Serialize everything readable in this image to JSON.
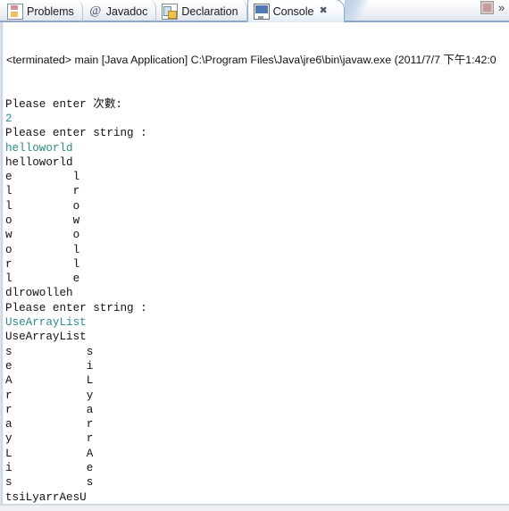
{
  "window": {
    "title": "Eclipse Console View"
  },
  "tabs": [
    {
      "label": "Problems",
      "icon": "problems-icon",
      "active": false,
      "closable": false
    },
    {
      "label": "Javadoc",
      "icon": "javadoc-icon",
      "active": false,
      "closable": false
    },
    {
      "label": "Declaration",
      "icon": "declaration-icon",
      "active": false,
      "closable": false
    },
    {
      "label": "Console",
      "icon": "console-icon",
      "active": true,
      "closable": true
    }
  ],
  "tab_close_glyph": "✖",
  "toolbar": {
    "terminate_icon": "stop-terminate-icon",
    "menu_icon": "view-menu-chevrons-icon",
    "menu_glyph": "»"
  },
  "console": {
    "launch_line": "<terminated> main [Java Application] C:\\Program Files\\Java\\jre6\\bin\\javaw.exe (2011/7/7 下午1:42:0",
    "colors": {
      "stdout": "#111111",
      "stdin": "#2e8b8b",
      "background": "#ffffff"
    },
    "lines": [
      {
        "text": "Please enter 次數:",
        "stream": "out"
      },
      {
        "text": "2",
        "stream": "in"
      },
      {
        "text": "Please enter string :",
        "stream": "out"
      },
      {
        "text": "helloworld",
        "stream": "in"
      },
      {
        "text": "helloworld",
        "stream": "out"
      },
      {
        "text": "e         l",
        "stream": "out"
      },
      {
        "text": "l         r",
        "stream": "out"
      },
      {
        "text": "l         o",
        "stream": "out"
      },
      {
        "text": "o         w",
        "stream": "out"
      },
      {
        "text": "w         o",
        "stream": "out"
      },
      {
        "text": "o         l",
        "stream": "out"
      },
      {
        "text": "r         l",
        "stream": "out"
      },
      {
        "text": "l         e",
        "stream": "out"
      },
      {
        "text": "dlrowolleh",
        "stream": "out"
      },
      {
        "text": "Please enter string :",
        "stream": "out"
      },
      {
        "text": "UseArrayList",
        "stream": "in"
      },
      {
        "text": "UseArrayList",
        "stream": "out"
      },
      {
        "text": "s           s",
        "stream": "out"
      },
      {
        "text": "e           i",
        "stream": "out"
      },
      {
        "text": "A           L",
        "stream": "out"
      },
      {
        "text": "r           y",
        "stream": "out"
      },
      {
        "text": "r           a",
        "stream": "out"
      },
      {
        "text": "a           r",
        "stream": "out"
      },
      {
        "text": "y           r",
        "stream": "out"
      },
      {
        "text": "L           A",
        "stream": "out"
      },
      {
        "text": "i           e",
        "stream": "out"
      },
      {
        "text": "s           s",
        "stream": "out"
      },
      {
        "text": "tsiLyarrAesU",
        "stream": "out"
      }
    ]
  }
}
